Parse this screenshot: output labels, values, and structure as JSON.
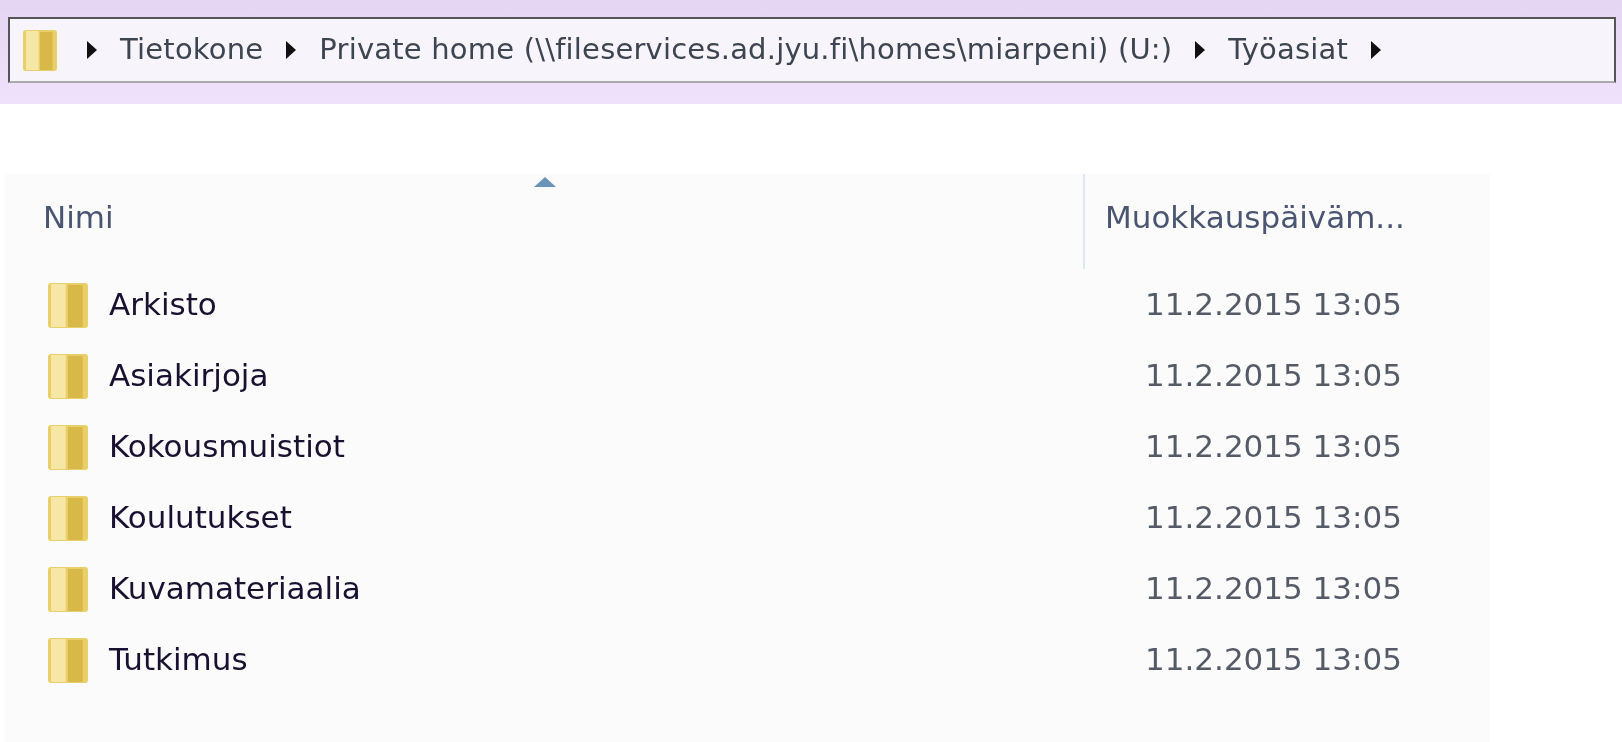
{
  "breadcrumb": [
    "Tietokone",
    "Private home (\\\\fileservices.ad.jyu.fi\\homes\\miarpeni) (U:)",
    "Työasiat"
  ],
  "columns": [
    {
      "label": "Nimi",
      "sorted": true
    },
    {
      "label": "Muokkauspäiväm...",
      "sorted": false
    }
  ],
  "rows": [
    {
      "name": "Arkisto",
      "modified": "11.2.2015 13:05"
    },
    {
      "name": "Asiakirjoja",
      "modified": "11.2.2015 13:05"
    },
    {
      "name": "Kokousmuistiot",
      "modified": "11.2.2015 13:05"
    },
    {
      "name": "Koulutukset",
      "modified": "11.2.2015 13:05"
    },
    {
      "name": "Kuvamateriaalia",
      "modified": "11.2.2015 13:05"
    },
    {
      "name": "Tutkimus",
      "modified": "11.2.2015 13:05"
    }
  ]
}
